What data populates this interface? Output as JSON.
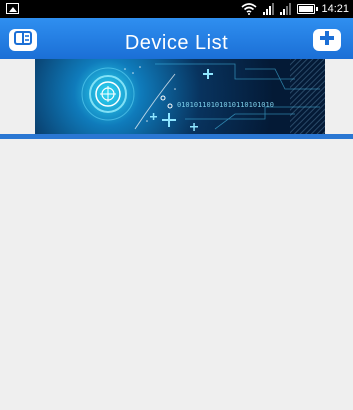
{
  "status_bar": {
    "time": "14:21",
    "icons": [
      "image-icon",
      "wifi-icon",
      "signal-icon",
      "signal-icon",
      "battery-icon"
    ]
  },
  "header": {
    "title": "Device List",
    "left_button_icon": "menu-list-icon",
    "right_button_icon": "plus-icon"
  },
  "banner": {
    "binary_text": "01010110101010110101010"
  },
  "device_list": {
    "items": []
  },
  "colors": {
    "header_blue": "#1b6fd6",
    "divider_blue": "#2a77d3",
    "background": "#efefef"
  }
}
